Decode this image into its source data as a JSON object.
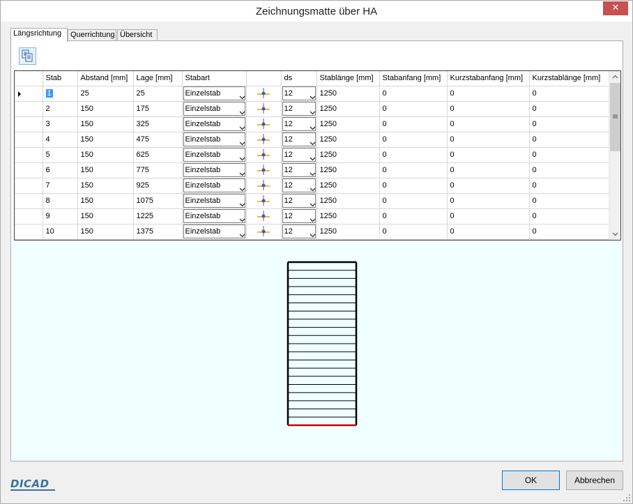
{
  "window": {
    "title": "Zeichnungsmatte über HA"
  },
  "tabs": [
    {
      "label": "Längsrichtung",
      "active": true
    },
    {
      "label": "Querrichtung",
      "active": false
    },
    {
      "label": "Übersicht",
      "active": false
    }
  ],
  "toolbar": {
    "copy_icon": "copy-icon"
  },
  "table": {
    "columns": [
      "Stab",
      "Abstand [mm]",
      "Lage [mm]",
      "Stabart",
      "",
      "ds",
      "Stablänge [mm]",
      "Stabanfang [mm]",
      "Kurzstabanfang [mm]",
      "Kurzstablänge [mm]"
    ],
    "rows": [
      {
        "stab": "1",
        "abstand": "25",
        "lage": "25",
        "stabart": "Einzelstab",
        "ds": "12",
        "stablaenge": "1250",
        "stabanfang": "0",
        "kurzstabanfang": "0",
        "kurzstablaenge": "0"
      },
      {
        "stab": "2",
        "abstand": "150",
        "lage": "175",
        "stabart": "Einzelstab",
        "ds": "12",
        "stablaenge": "1250",
        "stabanfang": "0",
        "kurzstabanfang": "0",
        "kurzstablaenge": "0"
      },
      {
        "stab": "3",
        "abstand": "150",
        "lage": "325",
        "stabart": "Einzelstab",
        "ds": "12",
        "stablaenge": "1250",
        "stabanfang": "0",
        "kurzstabanfang": "0",
        "kurzstablaenge": "0"
      },
      {
        "stab": "4",
        "abstand": "150",
        "lage": "475",
        "stabart": "Einzelstab",
        "ds": "12",
        "stablaenge": "1250",
        "stabanfang": "0",
        "kurzstabanfang": "0",
        "kurzstablaenge": "0"
      },
      {
        "stab": "5",
        "abstand": "150",
        "lage": "625",
        "stabart": "Einzelstab",
        "ds": "12",
        "stablaenge": "1250",
        "stabanfang": "0",
        "kurzstabanfang": "0",
        "kurzstablaenge": "0"
      },
      {
        "stab": "6",
        "abstand": "150",
        "lage": "775",
        "stabart": "Einzelstab",
        "ds": "12",
        "stablaenge": "1250",
        "stabanfang": "0",
        "kurzstabanfang": "0",
        "kurzstablaenge": "0"
      },
      {
        "stab": "7",
        "abstand": "150",
        "lage": "925",
        "stabart": "Einzelstab",
        "ds": "12",
        "stablaenge": "1250",
        "stabanfang": "0",
        "kurzstabanfang": "0",
        "kurzstablaenge": "0"
      },
      {
        "stab": "8",
        "abstand": "150",
        "lage": "1075",
        "stabart": "Einzelstab",
        "ds": "12",
        "stablaenge": "1250",
        "stabanfang": "0",
        "kurzstabanfang": "0",
        "kurzstablaenge": "0"
      },
      {
        "stab": "9",
        "abstand": "150",
        "lage": "1225",
        "stabart": "Einzelstab",
        "ds": "12",
        "stablaenge": "1250",
        "stabanfang": "0",
        "kurzstabanfang": "0",
        "kurzstablaenge": "0"
      },
      {
        "stab": "10",
        "abstand": "150",
        "lage": "1375",
        "stabart": "Einzelstab",
        "ds": "12",
        "stablaenge": "1250",
        "stabanfang": "0",
        "kurzstabanfang": "0",
        "kurzstablaenge": "0"
      }
    ]
  },
  "preview": {
    "bar_count": 21,
    "bar_color": "#000000",
    "highlight_color": "#cc0000"
  },
  "buttons": {
    "ok": "OK",
    "cancel": "Abbrechen"
  },
  "branding": {
    "logo": "DICAD"
  },
  "colors": {
    "accent": "#0078d7",
    "selection": "#3399ff",
    "preview_bg": "#f0ffff",
    "marker": "#e8a000"
  }
}
